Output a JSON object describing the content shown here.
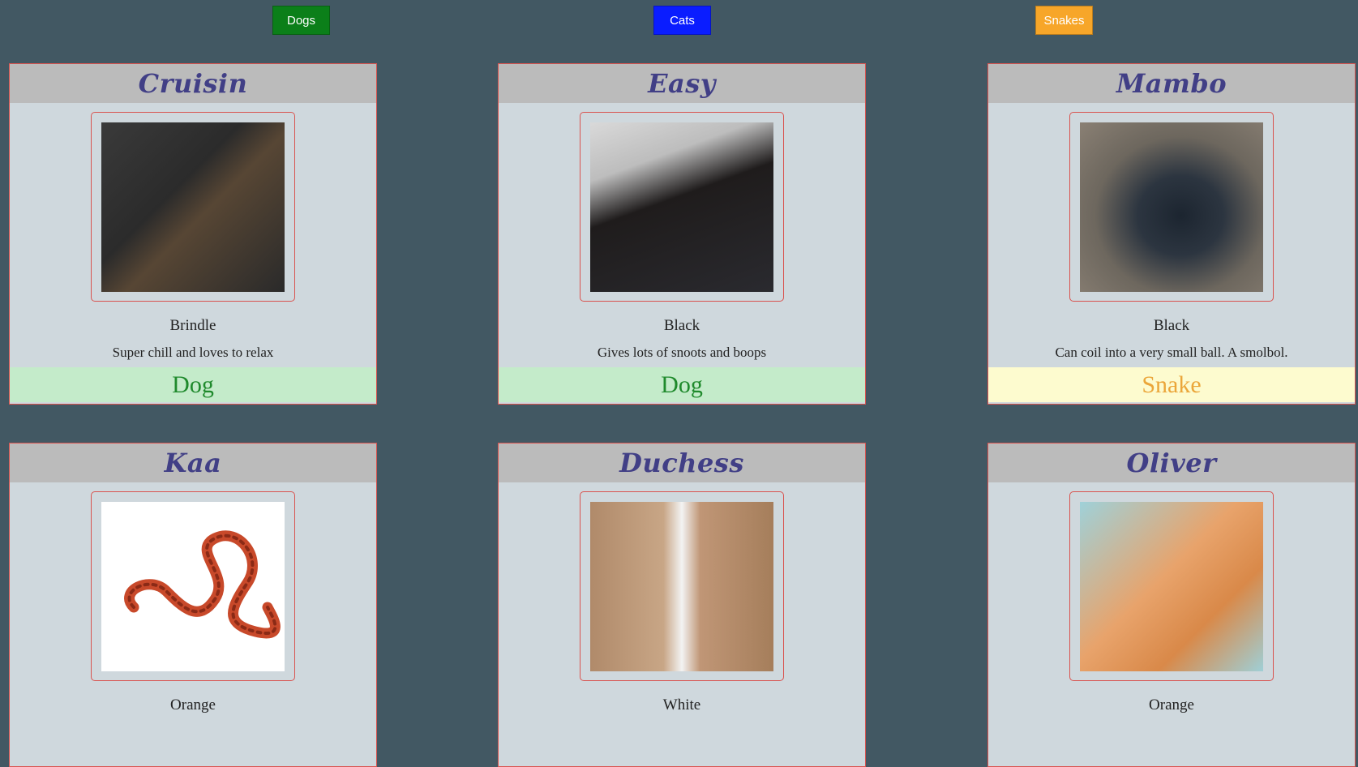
{
  "filters": {
    "dogs": {
      "label": "Dogs",
      "color": "#0b7f19"
    },
    "cats": {
      "label": "Cats",
      "color": "#0a1dff"
    },
    "snakes": {
      "label": "Snakes",
      "color": "#f7a629"
    }
  },
  "pets": [
    {
      "name": "Cruisin",
      "photo": "brindle-greyhound-photo",
      "color": "Brindle",
      "description": "Super chill and loves to relax",
      "type": "Dog"
    },
    {
      "name": "Easy",
      "photo": "black-greyhound-photo",
      "color": "Black",
      "description": "Gives lots of snoots and boops",
      "type": "Dog"
    },
    {
      "name": "Mambo",
      "photo": "black-snake-photo",
      "color": "Black",
      "description": "Can coil into a very small ball. A smolbol.",
      "type": "Snake"
    },
    {
      "name": "Kaa",
      "photo": "corn-snake-photo",
      "color": "Orange",
      "description": "",
      "type": ""
    },
    {
      "name": "Duchess",
      "photo": "white-cat-photo",
      "color": "White",
      "description": "",
      "type": ""
    },
    {
      "name": "Oliver",
      "photo": "orange-cat-photo",
      "color": "Orange",
      "description": "",
      "type": ""
    }
  ]
}
